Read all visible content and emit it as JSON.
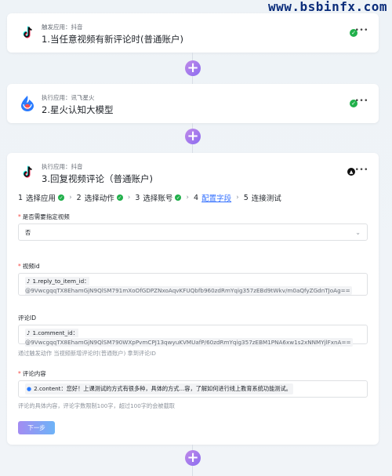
{
  "watermark": "www.bsbinfx.com",
  "nodes": [
    {
      "sub": "触发应用：抖音",
      "title": "1.当任意视频有新评论时(普通账户)",
      "app": "tiktok-icon"
    },
    {
      "sub": "执行应用：讯飞星火",
      "title": "2.星火认知大模型",
      "app": "spark-icon"
    },
    {
      "sub": "执行应用：抖音",
      "title": "3.回复视频评论（普通账户)",
      "app": "tiktok-icon"
    }
  ],
  "steps": [
    {
      "num": "1",
      "label": "选择应用",
      "done": true
    },
    {
      "num": "2",
      "label": "选择动作",
      "done": true
    },
    {
      "num": "3",
      "label": "选择账号",
      "done": true
    },
    {
      "num": "4",
      "label": "配置字段",
      "done": false,
      "active": true
    },
    {
      "num": "5",
      "label": "连接测试",
      "done": false
    }
  ],
  "form": {
    "specify_video": {
      "label": "是否需要指定视频",
      "value": "否"
    },
    "video_id": {
      "label": "视频id",
      "token_name": "1.reply_to_item_id：",
      "token_value": "@9VwcgqqTX8EhamGjN9QlSM791mXoOfGDPZNxoAqvKFUQbfb960zdRmYqig357zEBd9tWkv/m0aQfyZGdnTJoAg=="
    },
    "comment_id": {
      "label": "评论ID",
      "token_name": "1.comment_id：",
      "token_value": "@9VwcgqqTX8EhamGjN9QlSM790WXpPvmCPJ13qwyuKVMUafP/60zdRmYqig357zEBM1PNA6xw1s2xNNMYjlFxnA==",
      "hint": "通过触发动作 当视频新增评论时(普通账户) 拿到评论ID"
    },
    "reply_content": {
      "label": "评论内容",
      "token_name": "2.content：",
      "token_value": "您好！上课测试的方式有很多种，具体的方式...容，了解如何进行线上教育系统功能测试。",
      "hint": "评论的具体内容，评论字数限制100字，超过100字的会被截取"
    },
    "next_label": "下一步"
  },
  "colors": {
    "accent": "#3370ff",
    "success": "#21b04b",
    "required": "#f54a45",
    "plus_start": "#c08ae8",
    "plus_end": "#8b6cf0"
  }
}
